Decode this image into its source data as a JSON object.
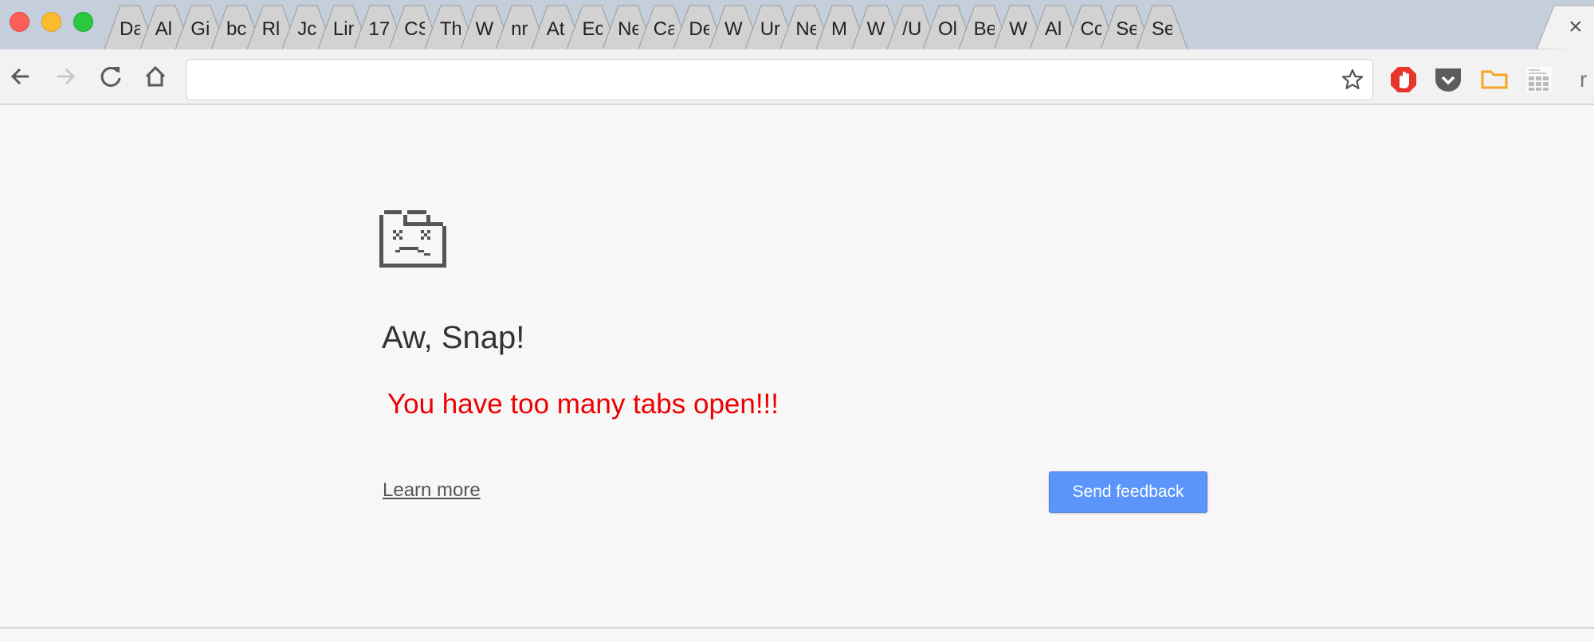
{
  "window": {
    "traffic_lights": [
      "close",
      "minimize",
      "zoom"
    ]
  },
  "tabs": [
    {
      "title": "Da"
    },
    {
      "title": "Al"
    },
    {
      "title": "Gi"
    },
    {
      "title": "bc"
    },
    {
      "title": "Rl"
    },
    {
      "title": "Jc"
    },
    {
      "title": "Lin"
    },
    {
      "title": "17"
    },
    {
      "title": "CS"
    },
    {
      "title": "Th"
    },
    {
      "title": "W"
    },
    {
      "title": "nr"
    },
    {
      "title": "At"
    },
    {
      "title": "Ec"
    },
    {
      "title": "Ne"
    },
    {
      "title": "Ca"
    },
    {
      "title": "De"
    },
    {
      "title": "W"
    },
    {
      "title": "Ur"
    },
    {
      "title": "Ne"
    },
    {
      "title": "M"
    },
    {
      "title": "W"
    },
    {
      "title": "/U"
    },
    {
      "title": "Ol"
    },
    {
      "title": "Be"
    },
    {
      "title": "W"
    },
    {
      "title": "Al"
    },
    {
      "title": "Cc"
    },
    {
      "title": "Se"
    },
    {
      "title": "Se"
    }
  ],
  "active_tab": {
    "title": "",
    "close_icon": "×"
  },
  "toolbar": {
    "back_icon": "arrow-left",
    "forward_icon": "arrow-right",
    "reload_icon": "reload",
    "home_icon": "home",
    "omnibox_value": "",
    "bookmark_icon": "star",
    "extensions": [
      "adblock-hand",
      "pocket",
      "folder",
      "new-tab-page-grid"
    ],
    "overflow_label": "r"
  },
  "error_page": {
    "icon": "sad-folder-icon",
    "heading": "Aw, Snap!",
    "message": "You have too many tabs open!!!",
    "learn_more": "Learn more",
    "send_feedback": "Send feedback"
  },
  "colors": {
    "message": "#ee0000",
    "button": "#5b95f9",
    "tabstrip": "#c5cedb"
  }
}
